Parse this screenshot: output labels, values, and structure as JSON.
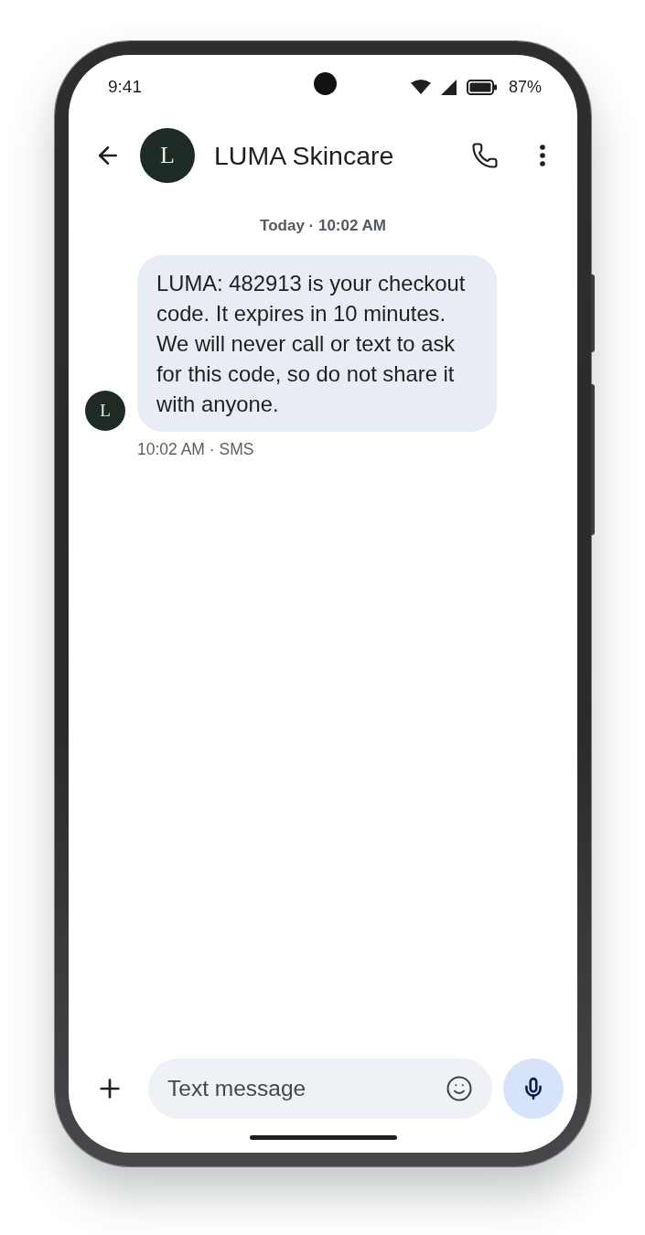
{
  "status_bar": {
    "time": "9:41",
    "battery": "87%"
  },
  "header": {
    "contact_initial": "L",
    "contact_name": "LUMA Skincare"
  },
  "conversation": {
    "date_divider": "Today · 10:02 AM",
    "messages": [
      {
        "kind": "incoming",
        "avatar_initial": "L",
        "text": "LUMA: 482913 is your checkout code. It expires in 10 minutes. We will never call or text to ask for this code, so do not share it with anyone.",
        "meta": "10:02 AM · SMS"
      }
    ]
  },
  "composer": {
    "placeholder": "Text message"
  }
}
